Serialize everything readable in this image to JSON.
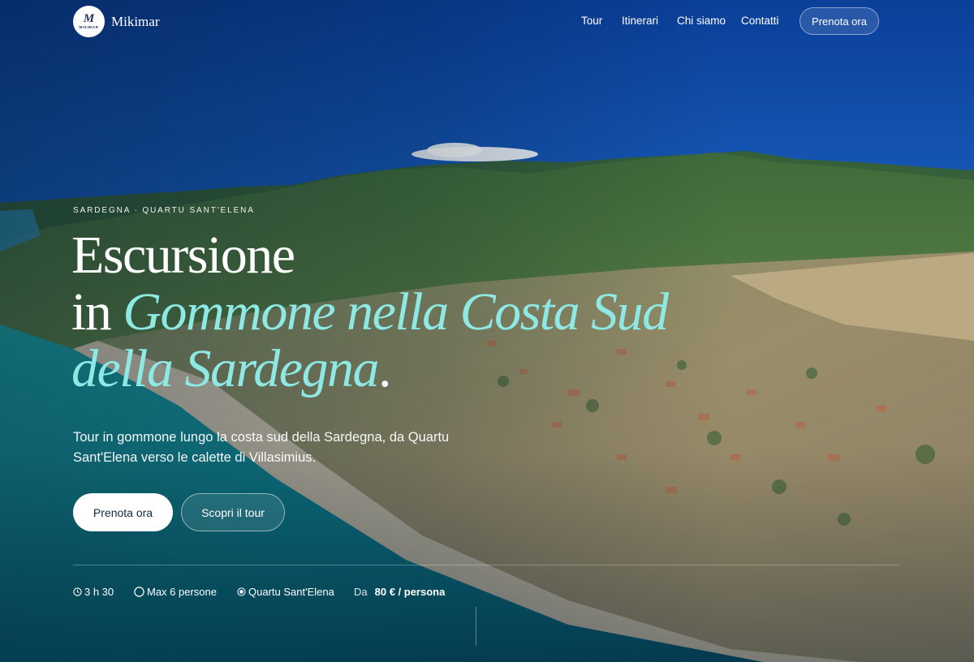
{
  "header": {
    "logo_mark": "M",
    "logo_small": "MIKIMAR",
    "brand": "Mikimar",
    "nav": [
      "Tour",
      "Itinerari",
      "Chi siamo",
      "Contatti"
    ],
    "cta": "Prenota ora"
  },
  "hero": {
    "eyebrow": "SARDEGNA · QUARTU SANT'ELENA",
    "title_line1": "Escursione",
    "title_line2_plain": "in ",
    "title_line2_accent": "Gommone nella Costa Sud",
    "title_line3_accent": "della Sardegna",
    "title_dot": ".",
    "subtitle": "Tour in gommone lungo la costa sud della Sardegna, da Quartu Sant'Elena verso le calette di Villasimius.",
    "primary_button": "Prenota ora",
    "secondary_button": "Scopri il tour"
  },
  "meta": {
    "duration": "3 h 30",
    "people": "Max 6 persone",
    "place": "Quartu Sant'Elena",
    "price_prefix": "Da",
    "price": "80 € / persona"
  },
  "icons": {
    "duration": "clock-icon",
    "people": "circle-icon",
    "place": "location-dot-icon"
  },
  "colors": {
    "accent": "#8ee8e4",
    "primary_button_bg": "#ffffff",
    "primary_button_text": "#0e2a3d"
  }
}
